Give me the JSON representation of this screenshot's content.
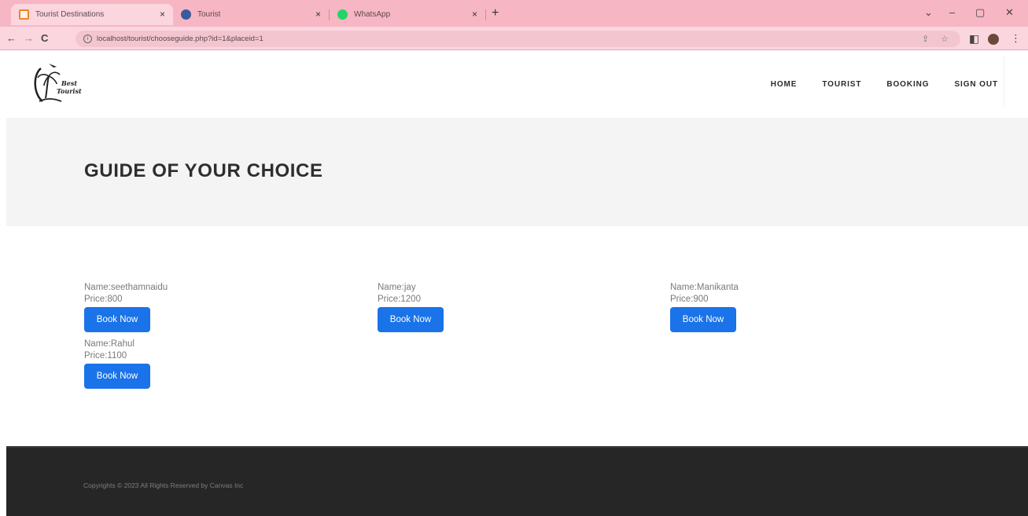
{
  "browser": {
    "tabs": [
      {
        "title": "Tourist Destinations",
        "favicon": "calendar-icon",
        "active": true
      },
      {
        "title": "Tourist",
        "favicon": "tourist-icon",
        "active": false
      },
      {
        "title": "WhatsApp",
        "favicon": "whatsapp-icon",
        "active": false
      }
    ],
    "close_glyph": "×",
    "new_tab_glyph": "+",
    "url": "localhost/tourist/chooseguide.php?id=1&placeid=1",
    "window_controls": {
      "dropdown": "⌄",
      "minimize": "–",
      "maximize": "▢",
      "close": "✕"
    },
    "nav": {
      "back": "←",
      "forward": "→",
      "reload": "C"
    },
    "toolbar": {
      "share": "⇪",
      "bookmark": "☆",
      "sidepanel": "◧",
      "menu": "⋮"
    }
  },
  "site": {
    "logo_lines": [
      "Best",
      "Tourist"
    ],
    "nav_items": [
      "HOME",
      "TOURIST",
      "BOOKING",
      "SIGN OUT"
    ]
  },
  "banner": {
    "title": "GUIDE OF YOUR CHOICE"
  },
  "guides": [
    {
      "name": "Name:seethamnaidu",
      "price": "Price:800",
      "button": "Book Now"
    },
    {
      "name": "Name:jay",
      "price": "Price:1200",
      "button": "Book Now"
    },
    {
      "name": "Name:Manikanta",
      "price": "Price:900",
      "button": "Book Now"
    },
    {
      "name": "Name:Rahul",
      "price": "Price:1100",
      "button": "Book Now"
    }
  ],
  "footer": {
    "copyright": "Copyrights © 2023 All Rights Reserved by Canvas Inc"
  },
  "colors": {
    "tabbar": "#f7b6c4",
    "accent": "#1a73e8",
    "footer": "#262626",
    "banner": "#f4f4f4"
  }
}
